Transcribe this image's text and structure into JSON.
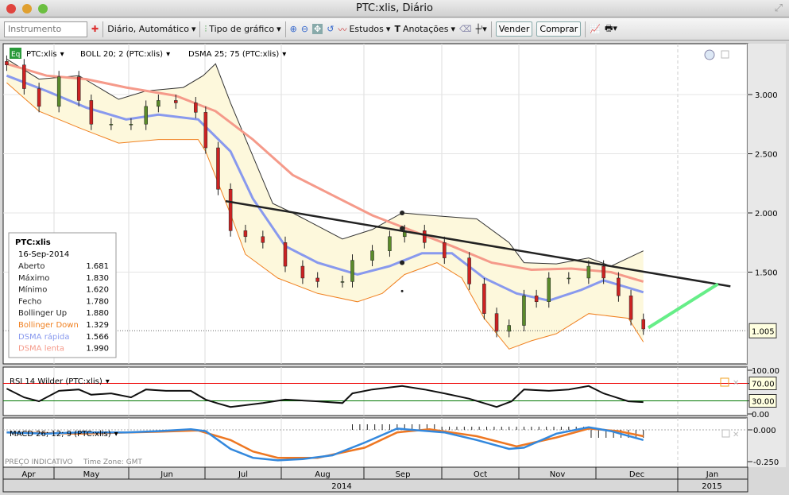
{
  "window": {
    "title": "PTC:xlis, Diário"
  },
  "toolbar": {
    "instrument_placeholder": "Instrumento",
    "period": "Diário,  Automático",
    "chart_type": "Tipo de gráfico",
    "studies": "Estudos",
    "annotations": "Anotações",
    "sell": "Vender",
    "buy": "Comprar"
  },
  "legend": {
    "symbol": "PTC:xlis",
    "boll": "BOLL 20; 2 (PTC:xlis)",
    "dsma": "DSMA 25; 75 (PTC:xlis)",
    "rsi": "RSI 14 Wilder (PTC:xlis)",
    "macd": "MACD 26; 12; 9 (PTC:xlis)",
    "eq": "Eq"
  },
  "info": {
    "title": "PTC:xlis",
    "date": "16-Sep-2014",
    "rows": [
      [
        "Aberto",
        "1.681"
      ],
      [
        "Máximo",
        "1.830"
      ],
      [
        "Mínimo",
        "1.620"
      ],
      [
        "Fecho",
        "1.780"
      ],
      [
        "Bollinger Up",
        "1.880"
      ],
      [
        "Bollinger Down",
        "1.329"
      ],
      [
        "DSMA rápida",
        "1.566"
      ],
      [
        "DSMA lenta",
        "1.990"
      ]
    ]
  },
  "footer": {
    "note": "PREÇO INDICATIVO",
    "tz": "Time Zone: GMT"
  },
  "colors": {
    "up": "#222",
    "boll": "#f08020",
    "fast": "#8899ee",
    "slow": "#f59a8a",
    "rsi70": "#ee0000",
    "rsi30": "#007700",
    "macd": "#3388dd",
    "signal": "#ee7722"
  },
  "chart_data": {
    "type": "candlestick",
    "x_unit": "days since 1-Apr-2014",
    "months": [
      "Apr",
      "May",
      "Jun",
      "Jul",
      "Aug",
      "Sep",
      "Oct",
      "Nov",
      "Dec",
      "Jan"
    ],
    "years": [
      "2014",
      "2015"
    ],
    "price_ticks": [
      "3.000",
      "2.500",
      "2.000",
      "1.500"
    ],
    "price_ylim": [
      0.9,
      3.35
    ],
    "last_price": "1.005",
    "close": [
      [
        11,
        3.25
      ],
      [
        18,
        3.05
      ],
      [
        24,
        2.9
      ],
      [
        32,
        3.15
      ],
      [
        40,
        2.95
      ],
      [
        45,
        2.75
      ],
      [
        53,
        2.75
      ],
      [
        61,
        2.75
      ],
      [
        67,
        2.9
      ],
      [
        72,
        2.95
      ],
      [
        79,
        2.93
      ],
      [
        87,
        2.85
      ],
      [
        91,
        2.55
      ],
      [
        96,
        2.2
      ],
      [
        101,
        1.85
      ],
      [
        107,
        1.8
      ],
      [
        114,
        1.75
      ],
      [
        123,
        1.55
      ],
      [
        130,
        1.45
      ],
      [
        136,
        1.42
      ],
      [
        146,
        1.42
      ],
      [
        150,
        1.6
      ],
      [
        158,
        1.68
      ],
      [
        165,
        1.8
      ],
      [
        171,
        1.85
      ],
      [
        179,
        1.75
      ],
      [
        187,
        1.62
      ],
      [
        197,
        1.4
      ],
      [
        203,
        1.15
      ],
      [
        208,
        1.0
      ],
      [
        213,
        1.05
      ],
      [
        219,
        1.3
      ],
      [
        224,
        1.25
      ],
      [
        229,
        1.45
      ],
      [
        237,
        1.45
      ],
      [
        245,
        1.55
      ],
      [
        251,
        1.45
      ],
      [
        257,
        1.3
      ],
      [
        262,
        1.1
      ],
      [
        267,
        1.02
      ]
    ],
    "boll_up": [
      [
        11,
        3.3
      ],
      [
        24,
        3.13
      ],
      [
        40,
        3.16
      ],
      [
        56,
        2.96
      ],
      [
        67,
        3.03
      ],
      [
        82,
        3.06
      ],
      [
        90,
        3.16
      ],
      [
        95,
        3.26
      ],
      [
        101,
        2.93
      ],
      [
        118,
        2.08
      ],
      [
        126,
        2.0
      ],
      [
        146,
        1.78
      ],
      [
        158,
        1.86
      ],
      [
        170,
        2.0
      ],
      [
        181,
        1.98
      ],
      [
        200,
        1.95
      ],
      [
        213,
        1.75
      ],
      [
        219,
        1.58
      ],
      [
        232,
        1.57
      ],
      [
        245,
        1.62
      ],
      [
        254,
        1.55
      ],
      [
        267,
        1.68
      ]
    ],
    "boll_down": [
      [
        11,
        3.1
      ],
      [
        24,
        2.86
      ],
      [
        40,
        2.72
      ],
      [
        56,
        2.59
      ],
      [
        72,
        2.62
      ],
      [
        88,
        2.62
      ],
      [
        91,
        2.52
      ],
      [
        101,
        1.99
      ],
      [
        107,
        1.65
      ],
      [
        120,
        1.45
      ],
      [
        136,
        1.32
      ],
      [
        152,
        1.25
      ],
      [
        162,
        1.32
      ],
      [
        171,
        1.48
      ],
      [
        184,
        1.58
      ],
      [
        194,
        1.45
      ],
      [
        203,
        1.11
      ],
      [
        213,
        0.85
      ],
      [
        222,
        0.92
      ],
      [
        232,
        0.98
      ],
      [
        245,
        1.15
      ],
      [
        261,
        1.11
      ],
      [
        267,
        0.91
      ]
    ],
    "dsma_fast": [
      [
        11,
        3.16
      ],
      [
        27,
        3.03
      ],
      [
        43,
        2.89
      ],
      [
        59,
        2.79
      ],
      [
        72,
        2.83
      ],
      [
        88,
        2.79
      ],
      [
        101,
        2.52
      ],
      [
        110,
        2.12
      ],
      [
        123,
        1.72
      ],
      [
        136,
        1.58
      ],
      [
        152,
        1.48
      ],
      [
        165,
        1.55
      ],
      [
        178,
        1.66
      ],
      [
        190,
        1.66
      ],
      [
        203,
        1.45
      ],
      [
        216,
        1.32
      ],
      [
        229,
        1.26
      ],
      [
        242,
        1.35
      ],
      [
        251,
        1.43
      ],
      [
        267,
        1.33
      ]
    ],
    "dsma_slow": [
      [
        11,
        3.26
      ],
      [
        27,
        3.16
      ],
      [
        43,
        3.13
      ],
      [
        59,
        3.06
      ],
      [
        79,
        2.99
      ],
      [
        95,
        2.86
      ],
      [
        110,
        2.62
      ],
      [
        126,
        2.32
      ],
      [
        142,
        2.15
      ],
      [
        158,
        1.98
      ],
      [
        174,
        1.85
      ],
      [
        190,
        1.72
      ],
      [
        206,
        1.58
      ],
      [
        222,
        1.52
      ],
      [
        238,
        1.53
      ],
      [
        254,
        1.5
      ],
      [
        267,
        1.42
      ]
    ],
    "trendline": [
      [
        99,
        2.1
      ],
      [
        302,
        1.38
      ]
    ],
    "projection": [
      [
        269,
        1.03
      ],
      [
        297,
        1.4
      ]
    ],
    "rsi": {
      "ticks": [
        "100.00",
        "70.00",
        "30.00",
        "0.00"
      ],
      "values": [
        [
          11,
          58
        ],
        [
          18,
          38
        ],
        [
          24,
          29
        ],
        [
          32,
          53
        ],
        [
          40,
          56
        ],
        [
          45,
          44
        ],
        [
          53,
          47
        ],
        [
          61,
          38
        ],
        [
          67,
          56
        ],
        [
          75,
          53
        ],
        [
          85,
          53
        ],
        [
          91,
          33
        ],
        [
          96,
          24
        ],
        [
          101,
          16
        ],
        [
          114,
          25
        ],
        [
          123,
          33
        ],
        [
          136,
          29
        ],
        [
          146,
          25
        ],
        [
          150,
          47
        ],
        [
          158,
          56
        ],
        [
          170,
          64
        ],
        [
          179,
          56
        ],
        [
          187,
          47
        ],
        [
          197,
          35
        ],
        [
          208,
          16
        ],
        [
          214,
          29
        ],
        [
          219,
          56
        ],
        [
          229,
          53
        ],
        [
          237,
          56
        ],
        [
          245,
          64
        ],
        [
          251,
          47
        ],
        [
          261,
          29
        ],
        [
          267,
          27
        ]
      ]
    },
    "macd": {
      "ticks": [
        "0.000",
        "-0.250"
      ],
      "macd": [
        [
          11,
          -0.02
        ],
        [
          27,
          -0.03
        ],
        [
          40,
          -0.02
        ],
        [
          59,
          -0.02
        ],
        [
          72,
          -0.01
        ],
        [
          85,
          0.005
        ],
        [
          91,
          -0.01
        ],
        [
          101,
          -0.15
        ],
        [
          110,
          -0.22
        ],
        [
          120,
          -0.24
        ],
        [
          130,
          -0.23
        ],
        [
          142,
          -0.2
        ],
        [
          155,
          -0.1
        ],
        [
          168,
          0.01
        ],
        [
          174,
          0.0
        ],
        [
          187,
          -0.02
        ],
        [
          200,
          -0.08
        ],
        [
          213,
          -0.15
        ],
        [
          219,
          -0.14
        ],
        [
          232,
          -0.03
        ],
        [
          245,
          0.02
        ],
        [
          254,
          -0.01
        ],
        [
          267,
          -0.08
        ]
      ],
      "signal": [
        [
          11,
          -0.02
        ],
        [
          40,
          -0.03
        ],
        [
          72,
          -0.015
        ],
        [
          88,
          -0.005
        ],
        [
          101,
          -0.08
        ],
        [
          110,
          -0.17
        ],
        [
          120,
          -0.22
        ],
        [
          136,
          -0.22
        ],
        [
          155,
          -0.14
        ],
        [
          168,
          -0.02
        ],
        [
          181,
          0.005
        ],
        [
          200,
          -0.05
        ],
        [
          216,
          -0.13
        ],
        [
          232,
          -0.06
        ],
        [
          245,
          0.01
        ],
        [
          257,
          -0.01
        ],
        [
          267,
          -0.05
        ]
      ]
    }
  }
}
